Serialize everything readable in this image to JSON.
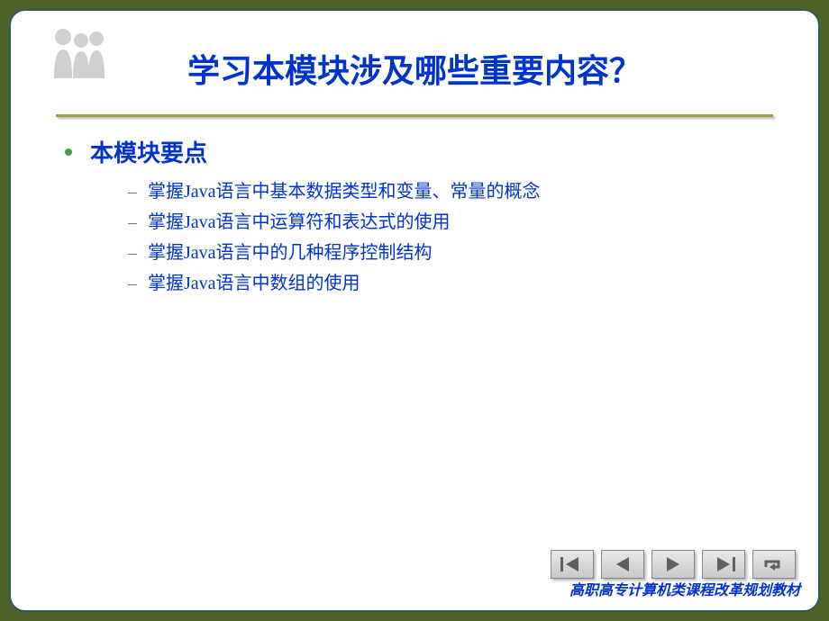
{
  "title": "学习本模块涉及哪些重要内容？",
  "mainPoint": "本模块要点",
  "subItems": [
    "掌握Java语言中基本数据类型和变量、常量的概念",
    "掌握Java语言中运算符和表达式的使用",
    "掌握Java语言中的几种程序控制结构",
    "掌握Java语言中数组的使用"
  ],
  "footer": "高职高专计算机类课程改革规划教材"
}
